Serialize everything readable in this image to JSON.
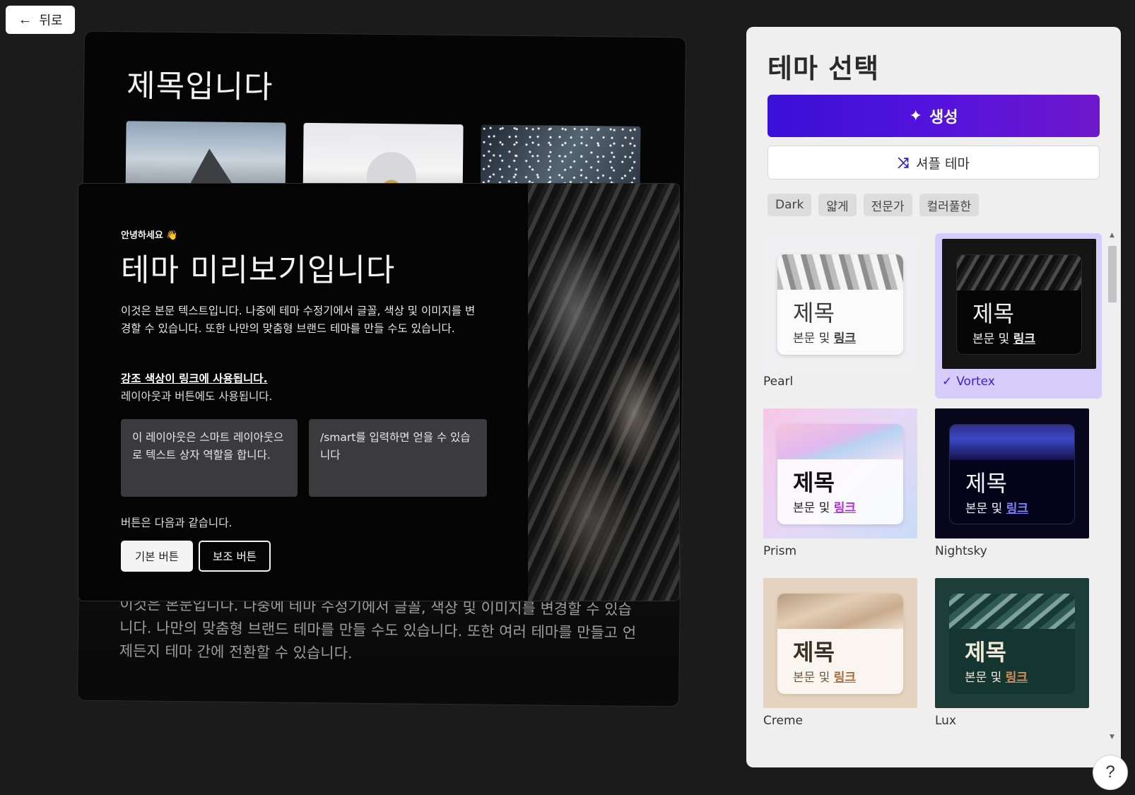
{
  "nav": {
    "back_label": "뒤로"
  },
  "preview_back": {
    "title": "제목입니다",
    "body": "이것은 본문입니다. 나중에 테마 수정기에서 글꼴, 색상 및 이미지를 변경할 수 있습니다. 나만의 맞춤형 브랜드 테마를 만들 수도 있습니다. 또한 여러 테마를 만들고 언제든지 테마 간에 전환할 수 있습니다."
  },
  "preview_front": {
    "greeting": "안녕하세요 👋",
    "title": "테마 미리보기입니다",
    "body": "이것은 본문 텍스트입니다. 나중에 테마 수정기에서 글꼴, 색상 및 이미지를 변경할 수 있습니다. 또한 나만의 맞춤형 브랜드 테마를 만들 수도 있습니다.",
    "accent": "강조 색상이 링크에 사용됩니다.",
    "layout_note": "레이아웃과 버튼에도 사용됩니다.",
    "smart_box_1": "이 레이아웃은 스마트 레이아웃으로 텍스트 상자 역할을 합니다.",
    "smart_box_2": "/smart를 입력하면 얻을 수 있습니다",
    "buttons_label": "버튼은 다음과 같습니다.",
    "primary_button": "기본 버튼",
    "secondary_button": "보조 버튼"
  },
  "panel": {
    "title": "테마 선택",
    "generate_label": "생성",
    "shuffle_label": "셔플 테마",
    "chips": [
      "Dark",
      "얇게",
      "전문가",
      "컬러풀한"
    ],
    "theme_heading": "제목",
    "theme_body_prefix": "본문 및",
    "theme_link": "링크",
    "themes": [
      {
        "name": "Pearl",
        "selected": false
      },
      {
        "name": "Vortex",
        "selected": true
      },
      {
        "name": "Prism",
        "selected": false
      },
      {
        "name": "Nightsky",
        "selected": false
      },
      {
        "name": "Creme",
        "selected": false
      },
      {
        "name": "Lux",
        "selected": false
      }
    ]
  },
  "help": {
    "label": "?"
  },
  "colors": {
    "accent": "#4a14d9",
    "selected_bg": "#d6ccfa",
    "page_bg": "#1b1b1c"
  }
}
